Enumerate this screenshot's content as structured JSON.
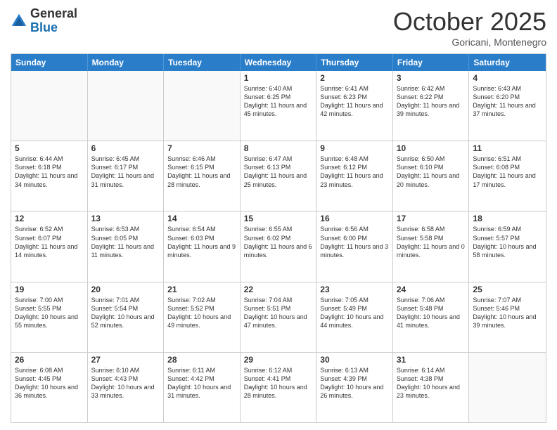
{
  "header": {
    "logo_general": "General",
    "logo_blue": "Blue",
    "month": "October 2025",
    "location": "Goricani, Montenegro"
  },
  "days_of_week": [
    "Sunday",
    "Monday",
    "Tuesday",
    "Wednesday",
    "Thursday",
    "Friday",
    "Saturday"
  ],
  "rows": [
    [
      {
        "day": "",
        "info": ""
      },
      {
        "day": "",
        "info": ""
      },
      {
        "day": "",
        "info": ""
      },
      {
        "day": "1",
        "info": "Sunrise: 6:40 AM\nSunset: 6:25 PM\nDaylight: 11 hours\nand 45 minutes."
      },
      {
        "day": "2",
        "info": "Sunrise: 6:41 AM\nSunset: 6:23 PM\nDaylight: 11 hours\nand 42 minutes."
      },
      {
        "day": "3",
        "info": "Sunrise: 6:42 AM\nSunset: 6:22 PM\nDaylight: 11 hours\nand 39 minutes."
      },
      {
        "day": "4",
        "info": "Sunrise: 6:43 AM\nSunset: 6:20 PM\nDaylight: 11 hours\nand 37 minutes."
      }
    ],
    [
      {
        "day": "5",
        "info": "Sunrise: 6:44 AM\nSunset: 6:18 PM\nDaylight: 11 hours\nand 34 minutes."
      },
      {
        "day": "6",
        "info": "Sunrise: 6:45 AM\nSunset: 6:17 PM\nDaylight: 11 hours\nand 31 minutes."
      },
      {
        "day": "7",
        "info": "Sunrise: 6:46 AM\nSunset: 6:15 PM\nDaylight: 11 hours\nand 28 minutes."
      },
      {
        "day": "8",
        "info": "Sunrise: 6:47 AM\nSunset: 6:13 PM\nDaylight: 11 hours\nand 25 minutes."
      },
      {
        "day": "9",
        "info": "Sunrise: 6:48 AM\nSunset: 6:12 PM\nDaylight: 11 hours\nand 23 minutes."
      },
      {
        "day": "10",
        "info": "Sunrise: 6:50 AM\nSunset: 6:10 PM\nDaylight: 11 hours\nand 20 minutes."
      },
      {
        "day": "11",
        "info": "Sunrise: 6:51 AM\nSunset: 6:08 PM\nDaylight: 11 hours\nand 17 minutes."
      }
    ],
    [
      {
        "day": "12",
        "info": "Sunrise: 6:52 AM\nSunset: 6:07 PM\nDaylight: 11 hours\nand 14 minutes."
      },
      {
        "day": "13",
        "info": "Sunrise: 6:53 AM\nSunset: 6:05 PM\nDaylight: 11 hours\nand 11 minutes."
      },
      {
        "day": "14",
        "info": "Sunrise: 6:54 AM\nSunset: 6:03 PM\nDaylight: 11 hours\nand 9 minutes."
      },
      {
        "day": "15",
        "info": "Sunrise: 6:55 AM\nSunset: 6:02 PM\nDaylight: 11 hours\nand 6 minutes."
      },
      {
        "day": "16",
        "info": "Sunrise: 6:56 AM\nSunset: 6:00 PM\nDaylight: 11 hours\nand 3 minutes."
      },
      {
        "day": "17",
        "info": "Sunrise: 6:58 AM\nSunset: 5:58 PM\nDaylight: 11 hours\nand 0 minutes."
      },
      {
        "day": "18",
        "info": "Sunrise: 6:59 AM\nSunset: 5:57 PM\nDaylight: 10 hours\nand 58 minutes."
      }
    ],
    [
      {
        "day": "19",
        "info": "Sunrise: 7:00 AM\nSunset: 5:55 PM\nDaylight: 10 hours\nand 55 minutes."
      },
      {
        "day": "20",
        "info": "Sunrise: 7:01 AM\nSunset: 5:54 PM\nDaylight: 10 hours\nand 52 minutes."
      },
      {
        "day": "21",
        "info": "Sunrise: 7:02 AM\nSunset: 5:52 PM\nDaylight: 10 hours\nand 49 minutes."
      },
      {
        "day": "22",
        "info": "Sunrise: 7:04 AM\nSunset: 5:51 PM\nDaylight: 10 hours\nand 47 minutes."
      },
      {
        "day": "23",
        "info": "Sunrise: 7:05 AM\nSunset: 5:49 PM\nDaylight: 10 hours\nand 44 minutes."
      },
      {
        "day": "24",
        "info": "Sunrise: 7:06 AM\nSunset: 5:48 PM\nDaylight: 10 hours\nand 41 minutes."
      },
      {
        "day": "25",
        "info": "Sunrise: 7:07 AM\nSunset: 5:46 PM\nDaylight: 10 hours\nand 39 minutes."
      }
    ],
    [
      {
        "day": "26",
        "info": "Sunrise: 6:08 AM\nSunset: 4:45 PM\nDaylight: 10 hours\nand 36 minutes."
      },
      {
        "day": "27",
        "info": "Sunrise: 6:10 AM\nSunset: 4:43 PM\nDaylight: 10 hours\nand 33 minutes."
      },
      {
        "day": "28",
        "info": "Sunrise: 6:11 AM\nSunset: 4:42 PM\nDaylight: 10 hours\nand 31 minutes."
      },
      {
        "day": "29",
        "info": "Sunrise: 6:12 AM\nSunset: 4:41 PM\nDaylight: 10 hours\nand 28 minutes."
      },
      {
        "day": "30",
        "info": "Sunrise: 6:13 AM\nSunset: 4:39 PM\nDaylight: 10 hours\nand 26 minutes."
      },
      {
        "day": "31",
        "info": "Sunrise: 6:14 AM\nSunset: 4:38 PM\nDaylight: 10 hours\nand 23 minutes."
      },
      {
        "day": "",
        "info": ""
      }
    ]
  ]
}
